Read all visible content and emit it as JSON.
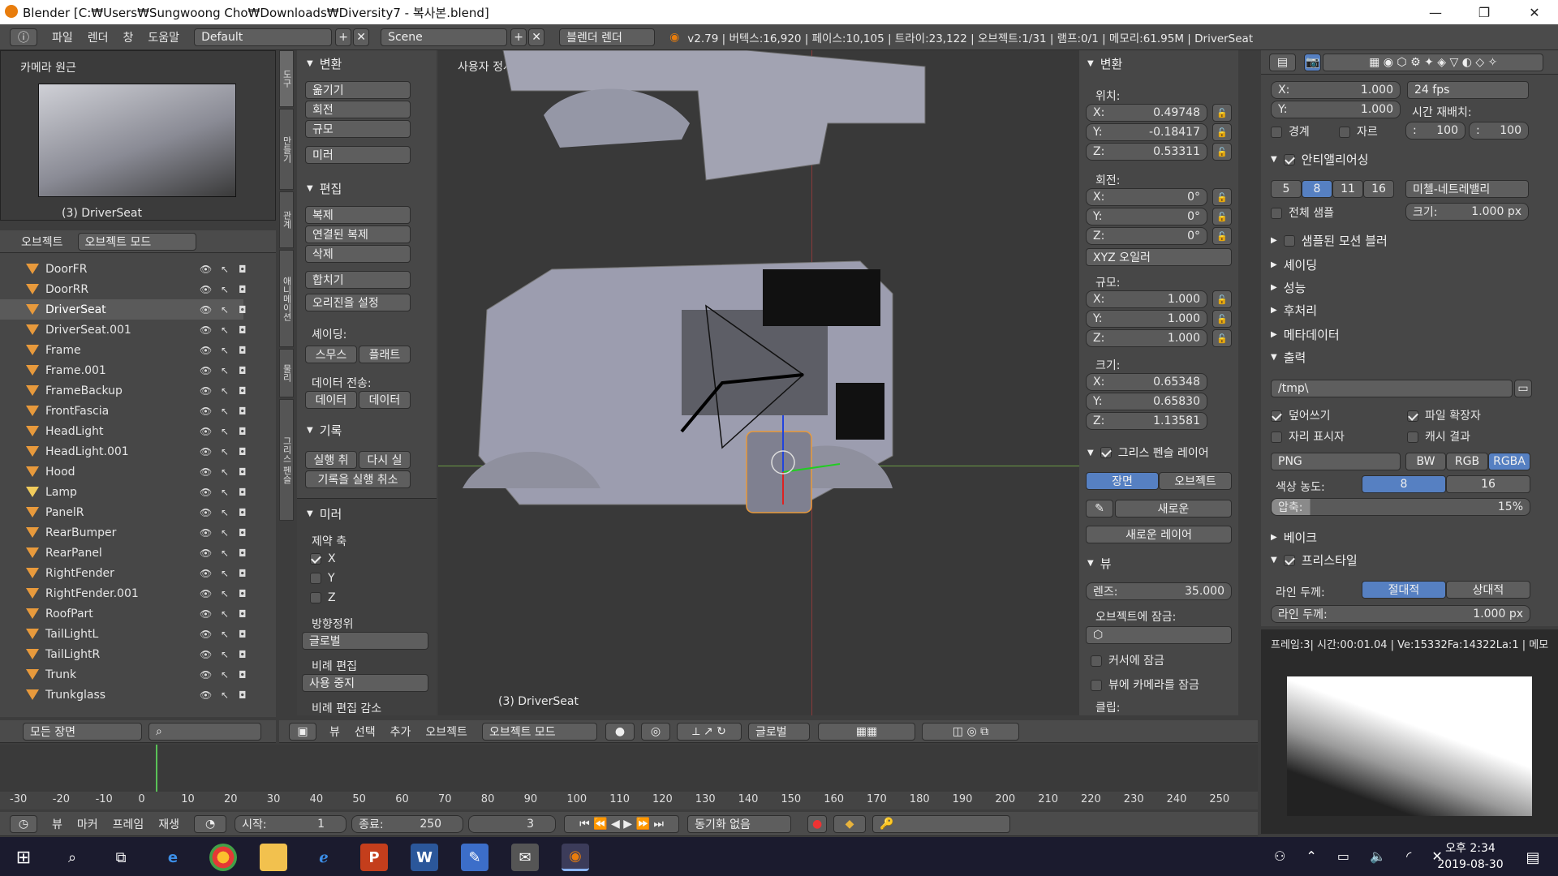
{
  "window": {
    "title": "Blender [C:₩Users₩Sungwoong Cho₩Downloads₩Diversity7 - 복사본.blend]",
    "min": "—",
    "max": "❐",
    "close": "✕"
  },
  "topbar": {
    "menus": [
      "파일",
      "렌더",
      "창",
      "도움말"
    ],
    "layout": "Default",
    "scene": "Scene",
    "engine": "블렌더 렌더",
    "stats": "v2.79 | 버텍스:16,920 | 페이스:10,105 | 트라이:23,122 | 오브젝트:1/31 | 램프:0/1 | 메모리:61.95M | DriverSeat"
  },
  "camview": {
    "title": "카메라 원근",
    "label": "(3) DriverSeat"
  },
  "outliner": {
    "header_label": "오브젝트",
    "mode": "오브젝트 모드",
    "filter": "모든 장면",
    "items": [
      {
        "name": "DoorFR"
      },
      {
        "name": "DoorRR"
      },
      {
        "name": "DriverSeat"
      },
      {
        "name": "DriverSeat.001"
      },
      {
        "name": "Frame"
      },
      {
        "name": "Frame.001"
      },
      {
        "name": "FrameBackup"
      },
      {
        "name": "FrontFascia"
      },
      {
        "name": "HeadLight"
      },
      {
        "name": "HeadLight.001"
      },
      {
        "name": "Hood"
      },
      {
        "name": "Lamp"
      },
      {
        "name": "PanelR"
      },
      {
        "name": "RearBumper"
      },
      {
        "name": "RearPanel"
      },
      {
        "name": "RightFender"
      },
      {
        "name": "RightFender.001"
      },
      {
        "name": "RoofPart"
      },
      {
        "name": "TailLightL"
      },
      {
        "name": "TailLightR"
      },
      {
        "name": "Trunk"
      },
      {
        "name": "Trunkglass"
      }
    ]
  },
  "tools": {
    "transform_title": "변환",
    "move": "옮기기",
    "rotate": "회전",
    "scale": "규모",
    "mirror": "미러",
    "edit_title": "편집",
    "duplicate": "복제",
    "dup_linked": "연결된 복제",
    "delete": "삭제",
    "join": "합치기",
    "set_origin": "오리진을 설정",
    "shading_label": "셰이딩:",
    "smooth": "스무스",
    "flat": "플래트",
    "data_transfer_label": "데이터 전송:",
    "data1": "데이터",
    "data2": "데이터",
    "history_title": "기록",
    "undo": "실행 취",
    "redo": "다시 실",
    "undo_history": "기록을 실행 취소",
    "mirror_panel": {
      "title": "미러",
      "constraint_axis": "제약 축",
      "x": "X",
      "y": "Y",
      "z": "Z",
      "orientation_label": "방향정위",
      "orientation": "글로벌",
      "proportional_label": "비례 편집",
      "proportional": "사용 중지",
      "cut": "비례 편집 감소"
    },
    "tabs": [
      "도구",
      "만들기",
      "관계",
      "애니메이션",
      "물리",
      "그리스 펜슬"
    ]
  },
  "viewport": {
    "title": "사용자 정사",
    "label": "(3) DriverSeat",
    "menus": [
      "뷰",
      "선택",
      "추가",
      "오브젝트"
    ],
    "mode": "오브젝트 모드",
    "orientation": "글로벌"
  },
  "npanel": {
    "transform_title": "변환",
    "location_label": "위치:",
    "loc": [
      {
        "a": "X:",
        "v": "0.49748"
      },
      {
        "a": "Y:",
        "v": "-0.18417"
      },
      {
        "a": "Z:",
        "v": "0.53311"
      }
    ],
    "rotation_label": "회전:",
    "rot": [
      {
        "a": "X:",
        "v": "0°"
      },
      {
        "a": "Y:",
        "v": "0°"
      },
      {
        "a": "Z:",
        "v": "0°"
      }
    ],
    "rotation_mode": "XYZ 오일러",
    "scale_label": "규모:",
    "scl": [
      {
        "a": "X:",
        "v": "1.000"
      },
      {
        "a": "Y:",
        "v": "1.000"
      },
      {
        "a": "Z:",
        "v": "1.000"
      }
    ],
    "dims_label": "크기:",
    "dim": [
      {
        "a": "X:",
        "v": "0.65348"
      },
      {
        "a": "Y:",
        "v": "0.65830"
      },
      {
        "a": "Z:",
        "v": "1.13581"
      }
    ],
    "gp_title": "그리스 펜슬 레이어",
    "gp_scene": "장면",
    "gp_object": "오브젝트",
    "gp_new": "새로운",
    "gp_new_layer": "새로운 레이어",
    "view_title": "뷰",
    "lens_label": "렌즈:",
    "lens": "35.000",
    "lock_obj_label": "오브젝트에 잠금:",
    "lock_cursor": "커서에 잠금",
    "lock_cam": "뷰에 카메라를 잠금",
    "clip_label": "클립:"
  },
  "props": {
    "res_x_label": "X:",
    "res_x": "1.000",
    "res_y_label": "Y:",
    "res_y": "1.000",
    "fps": "24 fps",
    "time_remap": "시간 재배치:",
    "border": "경계",
    "crop": "자르",
    "remap_old": "100",
    "remap_new": "100",
    "aa_title": "안티앨리어싱",
    "aa_samples": [
      "5",
      "8",
      "11",
      "16"
    ],
    "aa_filter": "미첼-네트레밸리",
    "full_sample": "전체 샘플",
    "size_label": "크기:",
    "size": "1.000 px",
    "motion_blur": "샘플된 모션 블러",
    "shading": "셰이딩",
    "performance": "성능",
    "post": "후처리",
    "metadata": "메타데이터",
    "output_title": "출력",
    "path": "/tmp\\",
    "overwrite": "덮어쓰기",
    "file_ext": "파일 확장자",
    "placeholder": "자리 표시자",
    "cache": "캐시 결과",
    "format": "PNG",
    "bw": "BW",
    "rgb": "RGB",
    "rgba": "RGBA",
    "depth_label": "색상 농도:",
    "depth8": "8",
    "depth16": "16",
    "compress_label": "압축:",
    "compress": "15%",
    "bake": "베이크",
    "freestyle": "프리스타일",
    "line_mode_label": "라인 두께:",
    "absolute": "절대적",
    "relative": "상대적",
    "line_label": "라인 두께:",
    "line_val": "1.000 px"
  },
  "render_info": "프레임:3| 시간:00:01.04 | Ve:15332Fa:14322La:1 | 메모",
  "timeline": {
    "menus": [
      "뷰",
      "마커",
      "프레임",
      "재생"
    ],
    "start_label": "시작:",
    "start": "1",
    "end_label": "종료:",
    "end": "250",
    "current": "3",
    "sync": "동기화 없음",
    "ticks": [
      "-30",
      "-20",
      "-10",
      "0",
      "10",
      "20",
      "30",
      "40",
      "50",
      "60",
      "70",
      "80",
      "90",
      "100",
      "110",
      "120",
      "130",
      "140",
      "150",
      "160",
      "170",
      "180",
      "190",
      "200",
      "210",
      "220",
      "230",
      "240",
      "250"
    ]
  },
  "taskbar": {
    "time": "오후 2:34",
    "date": "2019-08-30"
  }
}
